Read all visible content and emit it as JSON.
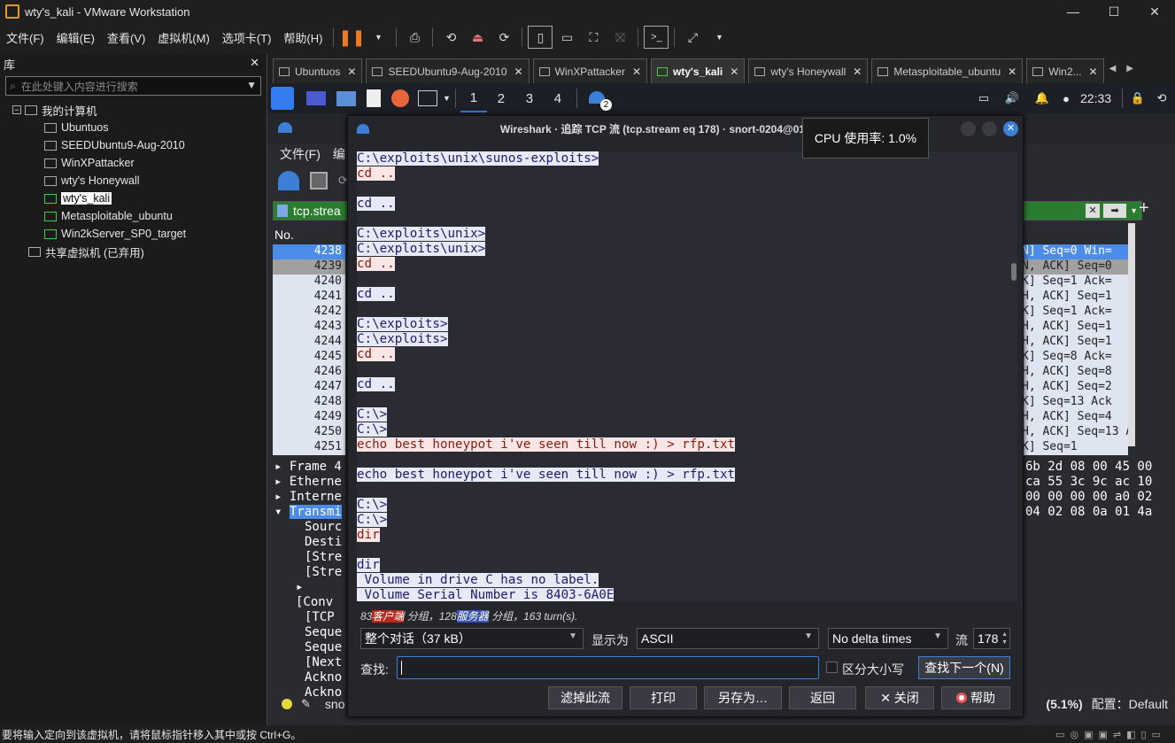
{
  "window": {
    "title": "wty's_kali - VMware Workstation"
  },
  "menu": [
    "文件(F)",
    "编辑(E)",
    "查看(V)",
    "虚拟机(M)",
    "选项卡(T)",
    "帮助(H)"
  ],
  "library": {
    "title": "库",
    "search_placeholder": "在此处键入内容进行搜索",
    "root": "我的计算机",
    "vms": [
      "Ubuntuos",
      "SEEDUbuntu9-Aug-2010",
      "WinXPattacker",
      "wty's Honeywall",
      "wty's_kali",
      "Metasploitable_ubuntu",
      "Win2kServer_SP0_target"
    ],
    "selected": "wty's_kali",
    "shared": "共享虚拟机 (已弃用)"
  },
  "tabs": [
    "Ubuntuos",
    "SEEDUbuntu9-Aug-2010",
    "WinXPattacker",
    "wty's_kali",
    "wty's Honeywall",
    "Metasploitable_ubuntu",
    "Win2..."
  ],
  "active_tab": "wty's_kali",
  "kali": {
    "workspaces": [
      "1",
      "2",
      "3",
      "4"
    ],
    "clock": "22:33",
    "badge": "2"
  },
  "wireshark": {
    "menu_file": "文件(F)",
    "menu_edit_partial": "编",
    "filter_text": "tcp.strea",
    "col_no": "No.",
    "rows": [
      "4238",
      "4239",
      "4240",
      "4241",
      "4242",
      "4243",
      "4244",
      "4245",
      "4246",
      "4247",
      "4248",
      "4249",
      "4250",
      "4251"
    ],
    "info_rows": [
      "N] Seq=0 Win=",
      "N, ACK] Seq=0",
      "K] Seq=1 Ack=",
      "H, ACK] Seq=1",
      "K] Seq=1 Ack=",
      "H, ACK] Seq=1",
      "H, ACK] Seq=1",
      "K] Seq=8 Ack=",
      "H, ACK] Seq=8",
      "H, ACK] Seq=2",
      "K] Seq=13 Ack",
      "H, ACK] Seq=4",
      "H, ACK] Seq=13 Ack",
      "K] Seq=1"
    ],
    "detail_rows": [
      "Frame 4",
      "Etherne",
      "Interne",
      "Transmi",
      "Sourc",
      "Desti",
      "[Stre",
      "[Stre",
      "[Conv",
      "[TCP",
      "Seque",
      "Seque",
      "[Next",
      "Ackno",
      "Ackno"
    ],
    "hex_rows": [
      "6b 2d 08 00 45 00",
      "ca 55 3c 9c ac 10",
      "00 00 00 00 a0 02",
      "04 02 08 0a 01 4a"
    ],
    "status_left": "sno",
    "status_pct": "(5.1%)",
    "status_profile": "配置：Default"
  },
  "dialog": {
    "title": "Wireshark · 追踪 TCP 流 (tcp.stream eq 178) · snort-0204@0117.log",
    "stream_lines": [
      {
        "t": "s",
        "text": "C:\\exploits\\unix\\sunos-exploits>"
      },
      {
        "t": "c",
        "text": "cd .."
      },
      {
        "t": "b",
        "text": ""
      },
      {
        "t": "s",
        "text": "cd .."
      },
      {
        "t": "b",
        "text": ""
      },
      {
        "t": "s",
        "text": "C:\\exploits\\unix>"
      },
      {
        "t": "s",
        "text": "C:\\exploits\\unix>"
      },
      {
        "t": "c",
        "text": "cd .."
      },
      {
        "t": "b",
        "text": ""
      },
      {
        "t": "s",
        "text": "cd .."
      },
      {
        "t": "b",
        "text": ""
      },
      {
        "t": "s",
        "text": "C:\\exploits>"
      },
      {
        "t": "s",
        "text": "C:\\exploits>"
      },
      {
        "t": "c",
        "text": "cd .."
      },
      {
        "t": "b",
        "text": ""
      },
      {
        "t": "s",
        "text": "cd .."
      },
      {
        "t": "b",
        "text": ""
      },
      {
        "t": "s",
        "text": "C:\\>"
      },
      {
        "t": "s",
        "text": "C:\\>"
      },
      {
        "t": "c",
        "text": "echo best honeypot i've seen till now :) > rfp.txt"
      },
      {
        "t": "b",
        "text": ""
      },
      {
        "t": "s",
        "text": "echo best honeypot i've seen till now :) > rfp.txt"
      },
      {
        "t": "b",
        "text": ""
      },
      {
        "t": "s",
        "text": "C:\\>"
      },
      {
        "t": "s",
        "text": "C:\\>"
      },
      {
        "t": "c",
        "text": "dir"
      },
      {
        "t": "b",
        "text": ""
      },
      {
        "t": "s",
        "text": "dir"
      },
      {
        "t": "s",
        "text": " Volume in drive C has no label."
      },
      {
        "t": "s",
        "text": " Volume Serial Number is 8403-6A0E"
      }
    ],
    "summary": {
      "clients": "83",
      "client_label": "客户端",
      "sep1": " 分组，",
      "servers": "128",
      "server_label": "服务器",
      "sep2": " 分组，",
      "turns": "163 turn(s)."
    },
    "conversation": "整个对话（37 kB）",
    "show_as_label": "显示为",
    "show_as": "ASCII",
    "delta": "No delta times",
    "stream_label": "流",
    "stream_value": "178",
    "find_label": "查找:",
    "case_label": "区分大小写",
    "find_next": "查找下一个(N)",
    "buttons": [
      "滤掉此流",
      "打印",
      "另存为…",
      "返回",
      "✕ 关闭",
      "帮助"
    ]
  },
  "tooltip": "CPU 使用率: 1.0%",
  "status_bar": "要将输入定向到该虚拟机，请将鼠标指针移入其中或按 Ctrl+G。"
}
